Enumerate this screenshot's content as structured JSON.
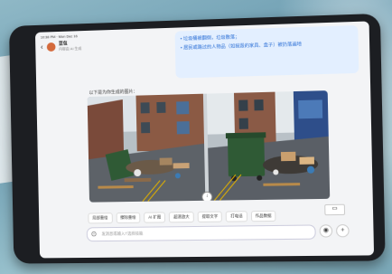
{
  "statusbar": {
    "time": "10:38 PM · Mon Dec 16"
  },
  "header": {
    "bot_name": "豆包",
    "bot_subtitle": "内容由 AI 生成"
  },
  "message": {
    "lines": [
      "• 垃圾桶被翻倒，垃圾散落；",
      "• 居民或路过的人物品（如损毁的家具、盒子）被扔落遍地"
    ]
  },
  "reply": {
    "caption": "以下是为你生成的图片："
  },
  "actions": [
    {
      "label": "局部重绘"
    },
    {
      "label": "擦除重绘"
    },
    {
      "label": "AI 扩图"
    },
    {
      "label": "超清放大"
    },
    {
      "label": "提取文字"
    },
    {
      "label": "打电话"
    },
    {
      "label": "作品数据"
    }
  ],
  "input": {
    "placeholder": "发消息或输入'/'选择技能"
  },
  "colors": {
    "accent": "#2b6fd6",
    "bubble": "#e3efff",
    "bin_green": "#2f5a35"
  }
}
